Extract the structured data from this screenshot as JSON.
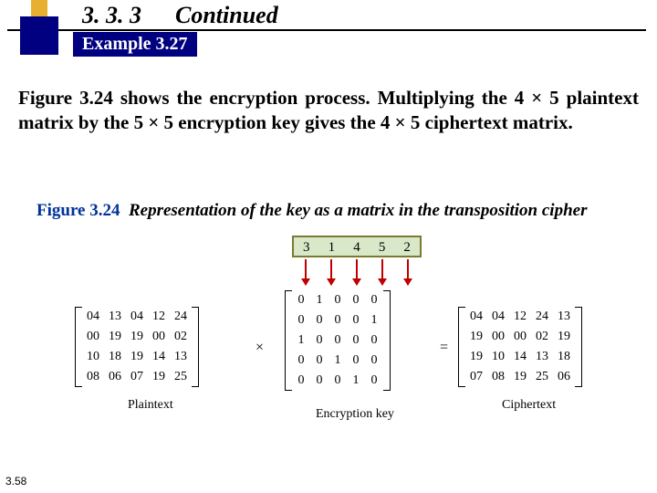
{
  "header": {
    "section_number": "3. 3. 3",
    "continued": "Continued",
    "example_label": "Example 3.27"
  },
  "body_paragraph": "Figure 3.24 shows the encryption process. Multiplying the 4 × 5 plaintext matrix by the 5 × 5 encryption key gives the 4 × 5 ciphertext matrix.",
  "figure": {
    "number": "Figure 3.24",
    "title": "Representation of the key as a matrix in the transposition cipher"
  },
  "key_row": [
    "3",
    "1",
    "4",
    "5",
    "2"
  ],
  "plaintext": {
    "label": "Plaintext",
    "rows": [
      [
        "04",
        "13",
        "04",
        "12",
        "24"
      ],
      [
        "00",
        "19",
        "19",
        "00",
        "02"
      ],
      [
        "10",
        "18",
        "19",
        "14",
        "13"
      ],
      [
        "08",
        "06",
        "07",
        "19",
        "25"
      ]
    ]
  },
  "encryption_key": {
    "label": "Encryption key",
    "rows": [
      [
        "0",
        "1",
        "0",
        "0",
        "0"
      ],
      [
        "0",
        "0",
        "0",
        "0",
        "1"
      ],
      [
        "1",
        "0",
        "0",
        "0",
        "0"
      ],
      [
        "0",
        "0",
        "1",
        "0",
        "0"
      ],
      [
        "0",
        "0",
        "0",
        "1",
        "0"
      ]
    ]
  },
  "ciphertext": {
    "label": "Ciphertext",
    "rows": [
      [
        "04",
        "04",
        "12",
        "24",
        "13"
      ],
      [
        "19",
        "00",
        "00",
        "02",
        "19"
      ],
      [
        "19",
        "10",
        "14",
        "13",
        "18"
      ],
      [
        "07",
        "08",
        "19",
        "25",
        "06"
      ]
    ]
  },
  "ops": {
    "times": "×",
    "equals": "="
  },
  "page_number": "3.58"
}
